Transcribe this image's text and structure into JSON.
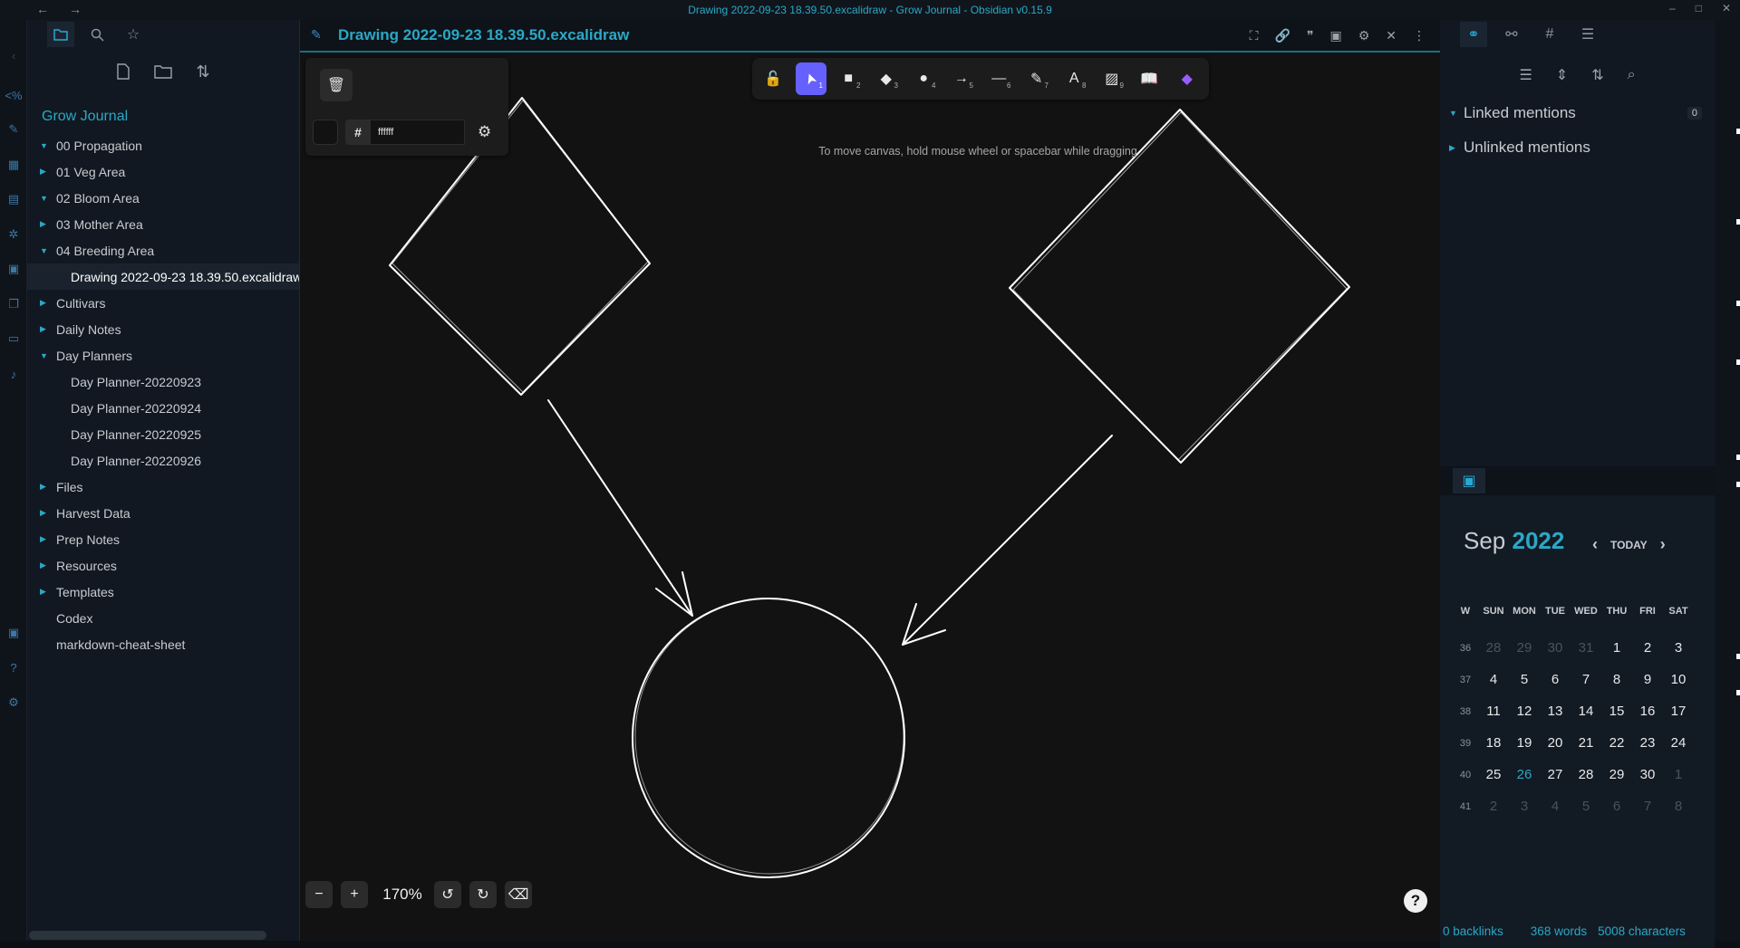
{
  "window": {
    "title": "Drawing 2022-09-23 18.39.50.excalidraw - Grow Journal - Obsidian v0.15.9"
  },
  "sidebar": {
    "vault_name": "Grow Journal",
    "items": [
      {
        "label": "00 Propagation",
        "type": "folder",
        "open": true
      },
      {
        "label": "01 Veg Area",
        "type": "folder",
        "open": false
      },
      {
        "label": "02 Bloom Area",
        "type": "folder",
        "open": true
      },
      {
        "label": "03 Mother Area",
        "type": "folder",
        "open": false
      },
      {
        "label": "04 Breeding Area",
        "type": "folder",
        "open": true
      },
      {
        "label": "Drawing 2022-09-23 18.39.50.excalidraw",
        "type": "child",
        "selected": true
      },
      {
        "label": "Cultivars",
        "type": "folder",
        "open": false
      },
      {
        "label": "Daily Notes",
        "type": "folder",
        "open": false
      },
      {
        "label": "Day Planners",
        "type": "folder",
        "open": true
      },
      {
        "label": "Day Planner-20220923",
        "type": "child"
      },
      {
        "label": "Day Planner-20220924",
        "type": "child"
      },
      {
        "label": "Day Planner-20220925",
        "type": "child"
      },
      {
        "label": "Day Planner-20220926",
        "type": "child"
      },
      {
        "label": "Files",
        "type": "folder",
        "open": false
      },
      {
        "label": "Harvest Data",
        "type": "folder",
        "open": false
      },
      {
        "label": "Prep Notes",
        "type": "folder",
        "open": false
      },
      {
        "label": "Resources",
        "type": "folder",
        "open": false
      },
      {
        "label": "Templates",
        "type": "folder",
        "open": false
      },
      {
        "label": "Codex",
        "type": "file"
      },
      {
        "label": "markdown-cheat-sheet",
        "type": "file"
      }
    ]
  },
  "editor": {
    "tab_title": "Drawing 2022-09-23 18.39.50.excalidraw",
    "properties": {
      "hex_value": "ffffff"
    },
    "toolbar": {
      "tools": [
        {
          "icon": "lock-open-icon",
          "key": ""
        },
        {
          "icon": "pointer-icon",
          "key": "1",
          "active": true
        },
        {
          "icon": "rectangle-icon",
          "key": "2"
        },
        {
          "icon": "diamond-icon",
          "key": "3"
        },
        {
          "icon": "ellipse-icon",
          "key": "4"
        },
        {
          "icon": "arrow-icon",
          "key": "5"
        },
        {
          "icon": "line-icon",
          "key": "6"
        },
        {
          "icon": "pencil-icon",
          "key": "7"
        },
        {
          "icon": "text-icon",
          "key": "8"
        },
        {
          "icon": "image-icon",
          "key": "9"
        },
        {
          "icon": "library-icon",
          "key": ""
        },
        {
          "icon": "obsidian-tools-icon",
          "key": ""
        }
      ]
    },
    "hint": "To move canvas, hold mouse wheel or spacebar while dragging",
    "zoom": "170%",
    "stroke_color": "#ffffff",
    "accent_color": "#6660ff"
  },
  "right_sidebar": {
    "linked_mentions": {
      "label": "Linked mentions",
      "count": "0"
    },
    "unlinked_mentions": {
      "label": "Unlinked mentions"
    },
    "calendar": {
      "month": "Sep",
      "year": "2022",
      "today_label": "TODAY",
      "weekday_headers": [
        "W",
        "SUN",
        "MON",
        "TUE",
        "WED",
        "THU",
        "FRI",
        "SAT"
      ],
      "weeks": [
        {
          "wk": "36",
          "days": [
            "28",
            "29",
            "30",
            "31",
            "1",
            "2",
            "3"
          ]
        },
        {
          "wk": "37",
          "days": [
            "4",
            "5",
            "6",
            "7",
            "8",
            "9",
            "10"
          ]
        },
        {
          "wk": "38",
          "days": [
            "11",
            "12",
            "13",
            "14",
            "15",
            "16",
            "17"
          ]
        },
        {
          "wk": "39",
          "days": [
            "18",
            "19",
            "20",
            "21",
            "22",
            "23",
            "24"
          ]
        },
        {
          "wk": "40",
          "days": [
            "25",
            "26",
            "27",
            "28",
            "29",
            "30",
            "1"
          ]
        },
        {
          "wk": "41",
          "days": [
            "2",
            "3",
            "4",
            "5",
            "6",
            "7",
            "8"
          ]
        }
      ],
      "today": "26"
    }
  },
  "status_bar": {
    "backlinks": "0 backlinks",
    "words": "368 words",
    "characters": "5008 characters"
  }
}
